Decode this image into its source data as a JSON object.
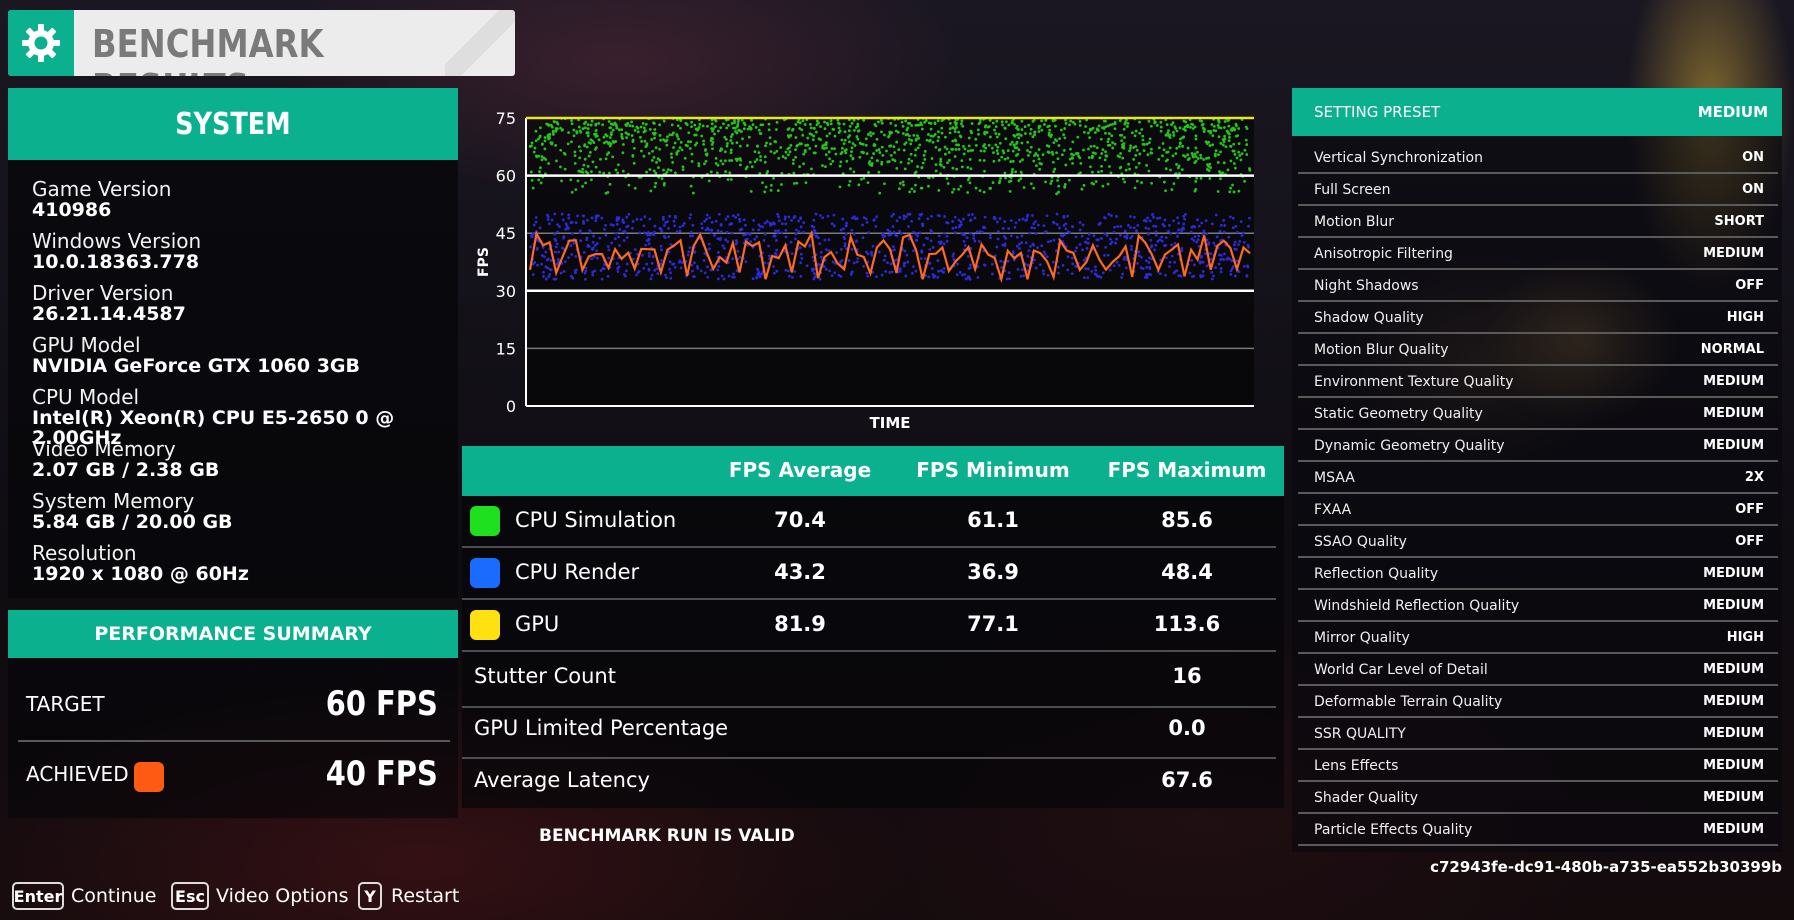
{
  "header": {
    "title": "BENCHMARK RESULTS",
    "icon": "gear-icon"
  },
  "system": {
    "title": "SYSTEM",
    "items": [
      {
        "label": "Game Version",
        "value": "410986"
      },
      {
        "label": "Windows Version",
        "value": "10.0.18363.778"
      },
      {
        "label": "Driver Version",
        "value": "26.21.14.4587"
      },
      {
        "label": "GPU Model",
        "value": "NVIDIA GeForce GTX 1060 3GB"
      },
      {
        "label": "CPU Model",
        "value": "Intel(R) Xeon(R) CPU E5-2650 0 @ 2.00GHz"
      },
      {
        "label": "Video Memory",
        "value": "2.07 GB / 2.38 GB"
      },
      {
        "label": "System Memory",
        "value": "5.84 GB / 20.00 GB"
      },
      {
        "label": "Resolution",
        "value": "1920 x 1080 @ 60Hz"
      }
    ]
  },
  "performance": {
    "title": "PERFORMANCE SUMMARY",
    "target_label": "TARGET",
    "target_value": "60 FPS",
    "achieved_label": "ACHIEVED",
    "achieved_value": "40 FPS",
    "achieved_color": "#ff5a14"
  },
  "chart_data": {
    "type": "scatter",
    "xlabel": "TIME",
    "ylabel": "FPS",
    "ylim": [
      0,
      75
    ],
    "yticks": [
      75,
      60,
      45,
      30,
      15,
      0
    ],
    "reference_lines": [
      {
        "y": 75,
        "color": "#e8e81a"
      },
      {
        "y": 60,
        "color": "#ffffff"
      },
      {
        "y": 30,
        "color": "#ffffff"
      }
    ],
    "series": [
      {
        "color": "#25c41c",
        "kind": "scatter",
        "y_range": [
          55,
          75
        ]
      },
      {
        "color": "#2a2ad8",
        "kind": "scatter",
        "y_range": [
          33,
          50
        ]
      },
      {
        "color": "#ff6a1e",
        "kind": "line",
        "y_range": [
          33,
          45
        ]
      }
    ]
  },
  "fps_table": {
    "headers": [
      "FPS Average",
      "FPS Minimum",
      "FPS Maximum"
    ],
    "rows": [
      {
        "name": "CPU Simulation",
        "color": "#1fe01f",
        "avg": "70.4",
        "min": "61.1",
        "max": "85.6"
      },
      {
        "name": "CPU Render",
        "color": "#1a6bff",
        "avg": "43.2",
        "min": "36.9",
        "max": "48.4"
      },
      {
        "name": "GPU",
        "color": "#ffe010",
        "avg": "81.9",
        "min": "77.1",
        "max": "113.6"
      }
    ],
    "stats": [
      {
        "name": "Stutter Count",
        "value": "16"
      },
      {
        "name": "GPU Limited Percentage",
        "value": "0.0"
      },
      {
        "name": "Average Latency",
        "value": "67.6"
      }
    ],
    "valid_text": "BENCHMARK RUN IS VALID"
  },
  "settings": {
    "preset_label": "SETTING PRESET",
    "preset_value": "MEDIUM",
    "items": [
      {
        "name": "Vertical Synchronization",
        "value": "ON"
      },
      {
        "name": "Full Screen",
        "value": "ON"
      },
      {
        "name": "Motion Blur",
        "value": "SHORT"
      },
      {
        "name": "Anisotropic Filtering",
        "value": "MEDIUM"
      },
      {
        "name": "Night Shadows",
        "value": "OFF"
      },
      {
        "name": "Shadow Quality",
        "value": "HIGH"
      },
      {
        "name": "Motion Blur Quality",
        "value": "NORMAL"
      },
      {
        "name": "Environment Texture Quality",
        "value": "MEDIUM"
      },
      {
        "name": "Static Geometry Quality",
        "value": "MEDIUM"
      },
      {
        "name": "Dynamic Geometry Quality",
        "value": "MEDIUM"
      },
      {
        "name": "MSAA",
        "value": "2X"
      },
      {
        "name": "FXAA",
        "value": "OFF"
      },
      {
        "name": "SSAO Quality",
        "value": "OFF"
      },
      {
        "name": "Reflection Quality",
        "value": "MEDIUM"
      },
      {
        "name": "Windshield Reflection Quality",
        "value": "MEDIUM"
      },
      {
        "name": "Mirror Quality",
        "value": "HIGH"
      },
      {
        "name": "World Car Level of Detail",
        "value": "MEDIUM"
      },
      {
        "name": "Deformable Terrain Quality",
        "value": "MEDIUM"
      },
      {
        "name": "SSR QUALITY",
        "value": "MEDIUM"
      },
      {
        "name": "Lens Effects",
        "value": "MEDIUM"
      },
      {
        "name": "Shader Quality",
        "value": "MEDIUM"
      },
      {
        "name": "Particle Effects Quality",
        "value": "MEDIUM"
      }
    ]
  },
  "run_id": "c72943fe-dc91-480b-a735-ea552b30399b",
  "footer": [
    {
      "key": "Enter",
      "label": "Continue"
    },
    {
      "key": "Esc",
      "label": "Video Options"
    },
    {
      "key": "Y",
      "label": "Restart"
    }
  ],
  "colors": {
    "accent": "#0bb08f"
  }
}
